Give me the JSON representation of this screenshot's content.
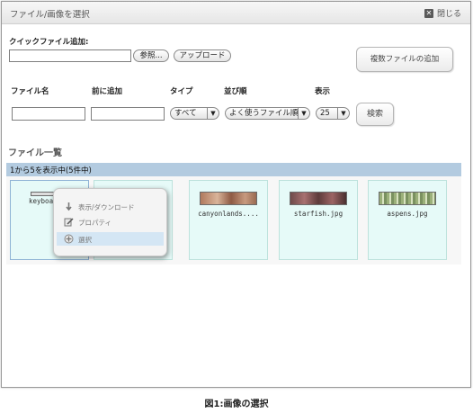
{
  "dialog": {
    "title": "ファイル/画像を選択",
    "close_label": "閉じる"
  },
  "quick_add": {
    "label": "クイックファイル追加:",
    "file_value": "",
    "browse_label": "参照...",
    "upload_label": "アップロード",
    "multi_add_label": "複数ファイルの追加"
  },
  "filters": {
    "filename_label": "ファイル名",
    "prefix_label": "前に追加",
    "type_label": "タイプ",
    "sort_label": "並び順",
    "display_label": "表示",
    "filename_value": "",
    "prefix_value": "",
    "type_value": "すべて",
    "sort_value": "よく使うファイル順",
    "display_value": "25",
    "search_label": "検索"
  },
  "list": {
    "title": "ファイル一覧",
    "range_text": "1から5を表示中(5件中)",
    "files": [
      {
        "name": "keyboard"
      },
      {
        "name": ""
      },
      {
        "name": "canyonlands...."
      },
      {
        "name": "starfish.jpg"
      },
      {
        "name": "aspens.jpg"
      }
    ]
  },
  "context_menu": {
    "items": [
      {
        "label": "表示/ダウンロード",
        "icon": "download-icon"
      },
      {
        "label": "プロパティ",
        "icon": "properties-icon"
      },
      {
        "label": "選択",
        "icon": "select-icon"
      }
    ]
  },
  "caption": "図1:画像の選択",
  "colors": {
    "list_header_bg": "#b3cbe0",
    "thumb_bg": "#e6faf8",
    "menu_highlight": "#d4e6f4"
  }
}
